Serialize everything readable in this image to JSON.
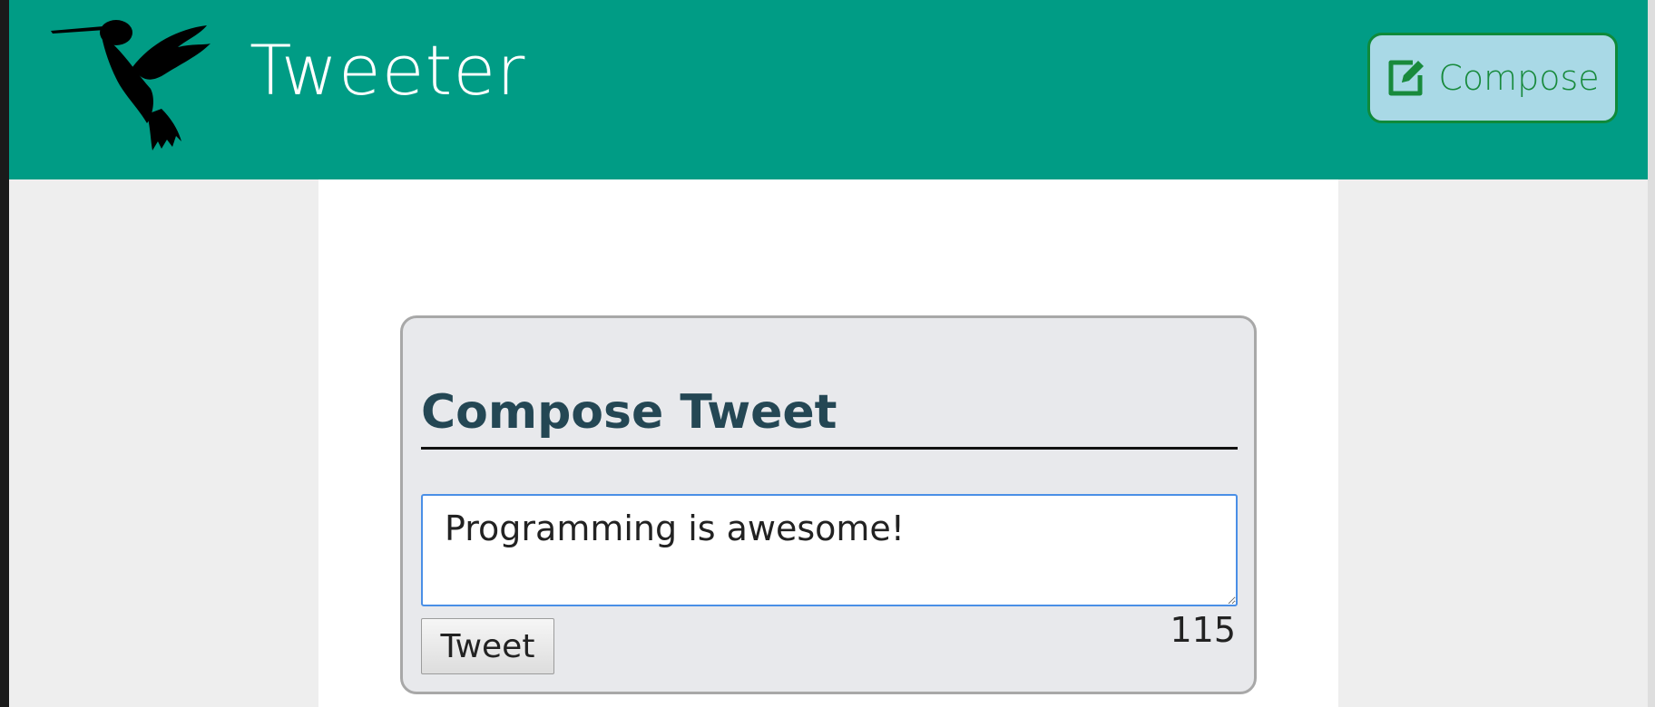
{
  "header": {
    "app_title": "Tweeter",
    "logo_icon": "hummingbird-icon",
    "compose_button": {
      "label": "Compose",
      "icon": "edit-icon"
    }
  },
  "compose_panel": {
    "heading": "Compose Tweet",
    "tweet_input": {
      "value": "Programming is awesome!"
    },
    "tweet_button_label": "Tweet",
    "char_count": "115"
  },
  "colors": {
    "header_bg": "#009c85",
    "compose_button_bg": "#a9d9e6",
    "compose_button_text": "#188a3c",
    "heading_text": "#244754",
    "panel_bg": "#e8e9ec",
    "page_bg": "#eeeeee",
    "input_focus_border": "#4a8fe6"
  }
}
